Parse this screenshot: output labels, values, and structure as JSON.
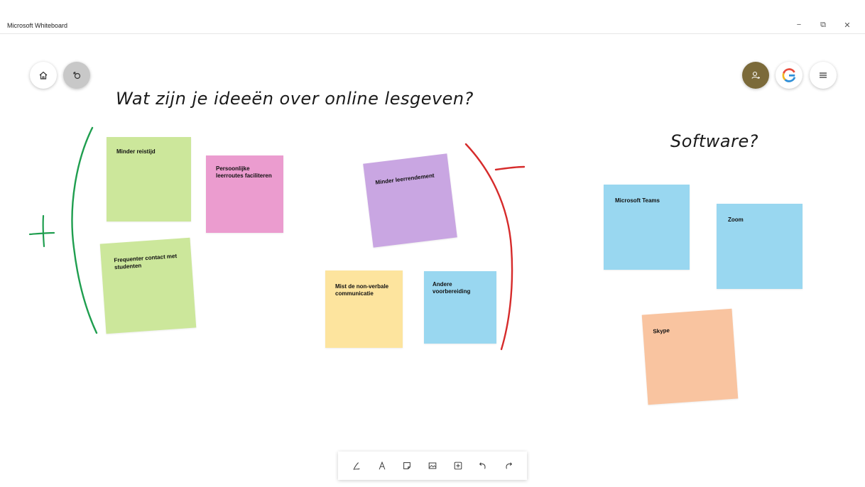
{
  "window": {
    "title": "Microsoft Whiteboard",
    "controls": {
      "minimize": "−",
      "restore": "⧉",
      "close": "✕"
    }
  },
  "canvas": {
    "heading": "Wat zijn je ideeën over online lesgeven?",
    "software_heading": "Software?",
    "notes": [
      {
        "text": "Minder reistijd",
        "color": "#cce79b"
      },
      {
        "text": "Persoonlijke leerroutes faciliteren",
        "color": "#eb9ccf"
      },
      {
        "text": "Frequenter contact met studenten",
        "color": "#cce79b"
      },
      {
        "text": "Minder leerrendement",
        "color": "#c9a6e2"
      },
      {
        "text": "Mist de non-verbale communicatie",
        "color": "#fde49e"
      },
      {
        "text": "Andere voorbereiding",
        "color": "#99d7f0"
      },
      {
        "text": "Microsoft Teams",
        "color": "#99d7f0"
      },
      {
        "text": "Zoom",
        "color": "#99d7f0"
      },
      {
        "text": "Skype",
        "color": "#f9c4a0"
      }
    ],
    "ink_colors": {
      "plus": "#1f9e4f",
      "minus": "#d62b2b"
    }
  },
  "nav": {
    "home_icon": "home-icon",
    "back_icon": "back-to-content-icon",
    "avatar_icon": "person-add-icon",
    "brand_icon": "brand-logo-icon",
    "menu_icon": "hamburger-menu-icon"
  },
  "toolbar": {
    "tools": [
      "pen-icon",
      "text-icon",
      "sticky-note-icon",
      "image-icon",
      "add-icon",
      "undo-icon",
      "redo-icon"
    ]
  }
}
